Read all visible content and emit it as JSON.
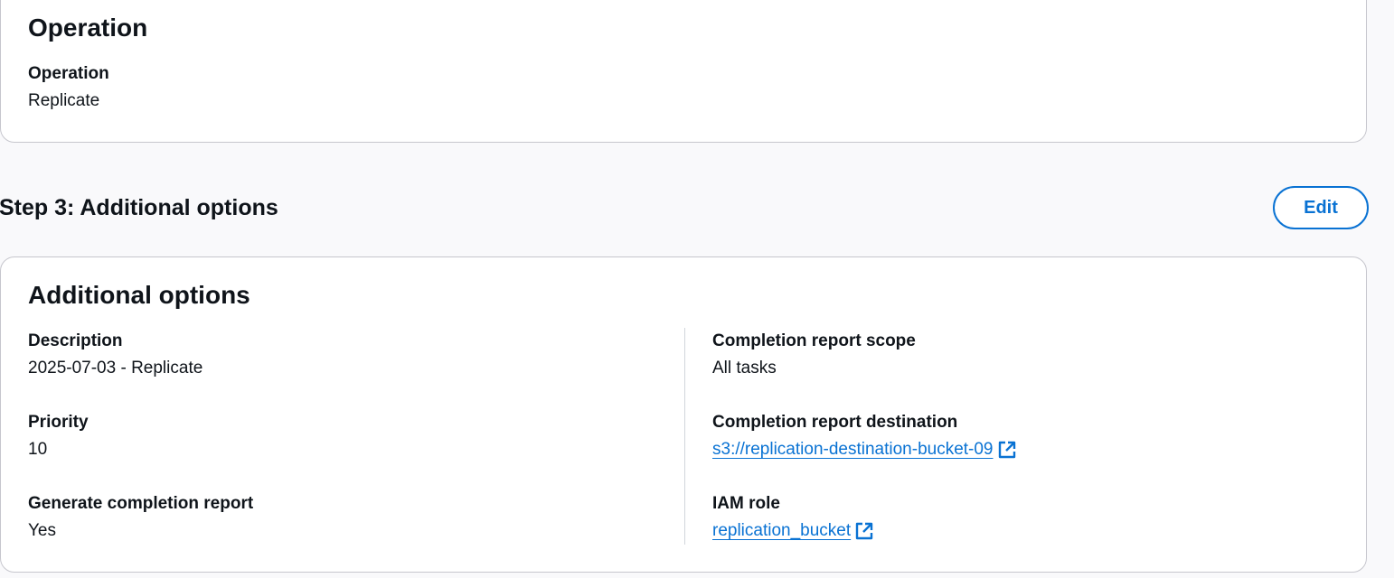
{
  "operation_card": {
    "title": "Operation",
    "fields": {
      "operation": {
        "label": "Operation",
        "value": "Replicate"
      }
    }
  },
  "step3": {
    "header": "Step 3: Additional options",
    "edit_label": "Edit"
  },
  "additional_card": {
    "title": "Additional options",
    "left": {
      "description": {
        "label": "Description",
        "value": "2025-07-03 - Replicate"
      },
      "priority": {
        "label": "Priority",
        "value": "10"
      },
      "generate_report": {
        "label": "Generate completion report",
        "value": "Yes"
      }
    },
    "right": {
      "report_scope": {
        "label": "Completion report scope",
        "value": "All tasks"
      },
      "report_destination": {
        "label": "Completion report destination",
        "value": "s3://replication-destination-bucket-09",
        "icon": "external-link-icon"
      },
      "iam_role": {
        "label": "IAM role",
        "value": "replication_bucket",
        "icon": "external-link-icon"
      }
    }
  },
  "colors": {
    "link": "#0972d3",
    "text": "#0f141a",
    "background": "#f9f9fb",
    "card_border": "#c6c6cd"
  }
}
